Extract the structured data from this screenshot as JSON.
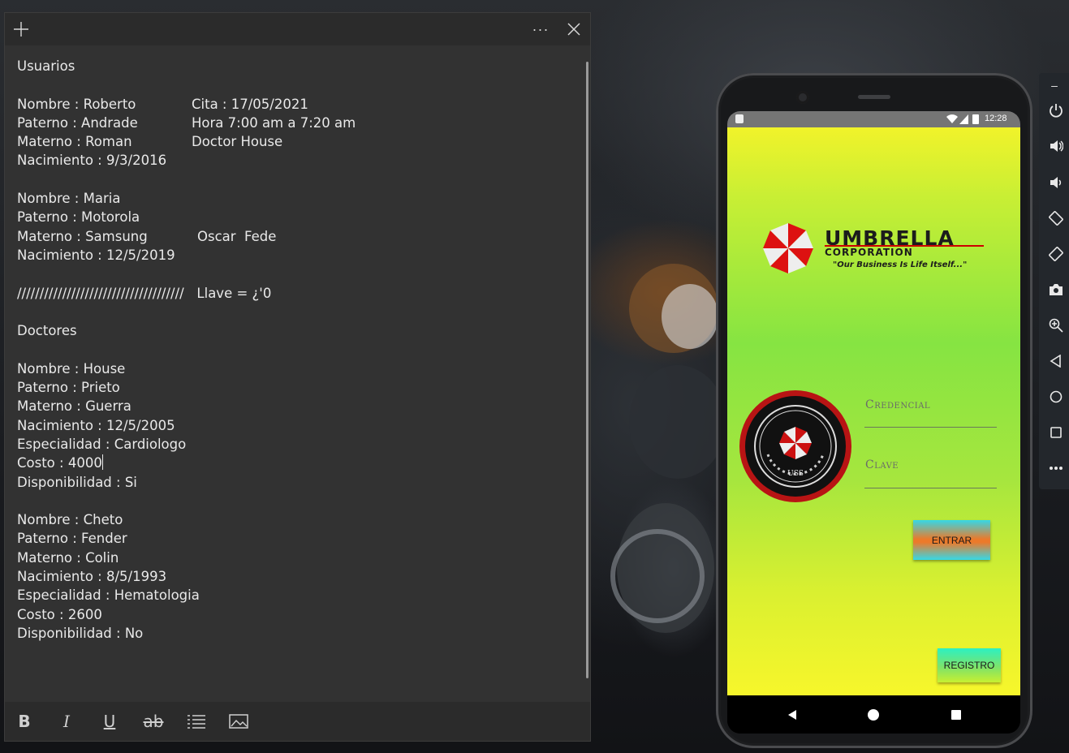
{
  "note": {
    "title_buttons": {
      "new": "+",
      "more": "···",
      "close": "✕"
    },
    "lines": [
      {
        "a": "Usuarios",
        "b": ""
      },
      {
        "a": "",
        "b": ""
      },
      {
        "a": "Nombre : Roberto",
        "b": "Cita : 17/05/2021"
      },
      {
        "a": "Paterno : Andrade",
        "b": "Hora 7:00 am a 7:20 am"
      },
      {
        "a": "Materno : Roman",
        "b": "Doctor House"
      },
      {
        "a": "Nacimiento : 9/3/2016",
        "b": ""
      },
      {
        "a": "",
        "b": ""
      },
      {
        "a": "Nombre : Maria",
        "b": ""
      },
      {
        "a": "Paterno : Motorola",
        "b": ""
      },
      {
        "a": "Materno : Samsung",
        "c": "Oscar  Fede"
      },
      {
        "a": "Nacimiento : 12/5/2019",
        "b": ""
      },
      {
        "a": "",
        "b": ""
      },
      {
        "a": "/////////////////////////////////////   Llave = ¿'0",
        "b": ""
      },
      {
        "a": "",
        "b": ""
      },
      {
        "a": "Doctores",
        "b": ""
      },
      {
        "a": "",
        "b": ""
      },
      {
        "a": "Nombre : House",
        "b": ""
      },
      {
        "a": "Paterno : Prieto",
        "b": ""
      },
      {
        "a": "Materno : Guerra",
        "b": ""
      },
      {
        "a": "Nacimiento : 12/5/2005",
        "b": ""
      },
      {
        "a": "Especialidad : Cardiologo",
        "b": ""
      },
      {
        "a": "Costo : 4000",
        "b": ""
      },
      {
        "a": "Disponibilidad : Si",
        "b": ""
      },
      {
        "a": "",
        "b": ""
      },
      {
        "a": "Nombre : Cheto",
        "b": ""
      },
      {
        "a": "Paterno : Fender",
        "b": ""
      },
      {
        "a": "Materno : Colin",
        "b": ""
      },
      {
        "a": "Nacimiento : 8/5/1993",
        "b": ""
      },
      {
        "a": "Especialidad : Hematologia",
        "b": ""
      },
      {
        "a": "Costo : 2600",
        "b": ""
      },
      {
        "a": "Disponibilidad : No",
        "b": ""
      }
    ],
    "toolbar": {
      "bold": "B",
      "italic": "I",
      "underline": "U",
      "strikethrough": "ab"
    }
  },
  "phone": {
    "status": {
      "time": "12:28"
    },
    "app": {
      "brand_name": "UMBRELLA",
      "brand_sub": "CORPORATION",
      "brand_tagline": "\"Our Business Is Life Itself...\"",
      "badge_text": "UMBRELLA SECURITY",
      "badge_initials": "USS",
      "credential_placeholder": "Credencial",
      "password_placeholder": "Clave",
      "login_button": "ENTRAR",
      "register_button": "REGISTRO"
    },
    "colors": {
      "accent_red": "#cc0000",
      "app_top": "#f1f32a",
      "app_mid": "#86e442"
    }
  },
  "emulator_toolbar": {
    "minimize": "–",
    "items": [
      "power-icon",
      "volume-up-icon",
      "volume-down-icon",
      "rotate-left-icon",
      "rotate-right-icon",
      "camera-icon",
      "zoom-icon",
      "back-icon",
      "home-icon",
      "overview-icon",
      "more-icon"
    ]
  }
}
